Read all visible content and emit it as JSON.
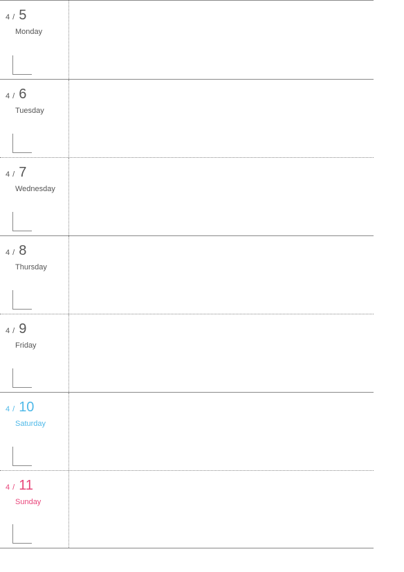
{
  "planner": {
    "days": [
      {
        "month": "4",
        "slash": "/",
        "day": "5",
        "name": "Monday",
        "colorClass": "",
        "topClass": ""
      },
      {
        "month": "4",
        "slash": "/",
        "day": "6",
        "name": "Tuesday",
        "colorClass": "",
        "topClass": "solid-top"
      },
      {
        "month": "4",
        "slash": "/",
        "day": "7",
        "name": "Wednesday",
        "colorClass": "",
        "topClass": "dotted-top"
      },
      {
        "month": "4",
        "slash": "/",
        "day": "8",
        "name": "Thursday",
        "colorClass": "",
        "topClass": "solid-top"
      },
      {
        "month": "4",
        "slash": "/",
        "day": "9",
        "name": "Friday",
        "colorClass": "",
        "topClass": "dotted-top"
      },
      {
        "month": "4",
        "slash": "/",
        "day": "10",
        "name": "Saturday",
        "colorClass": "color-sat",
        "topClass": "solid-top"
      },
      {
        "month": "4",
        "slash": "/",
        "day": "11",
        "name": "Sunday",
        "colorClass": "color-sun",
        "topClass": "dotted-top"
      }
    ]
  }
}
